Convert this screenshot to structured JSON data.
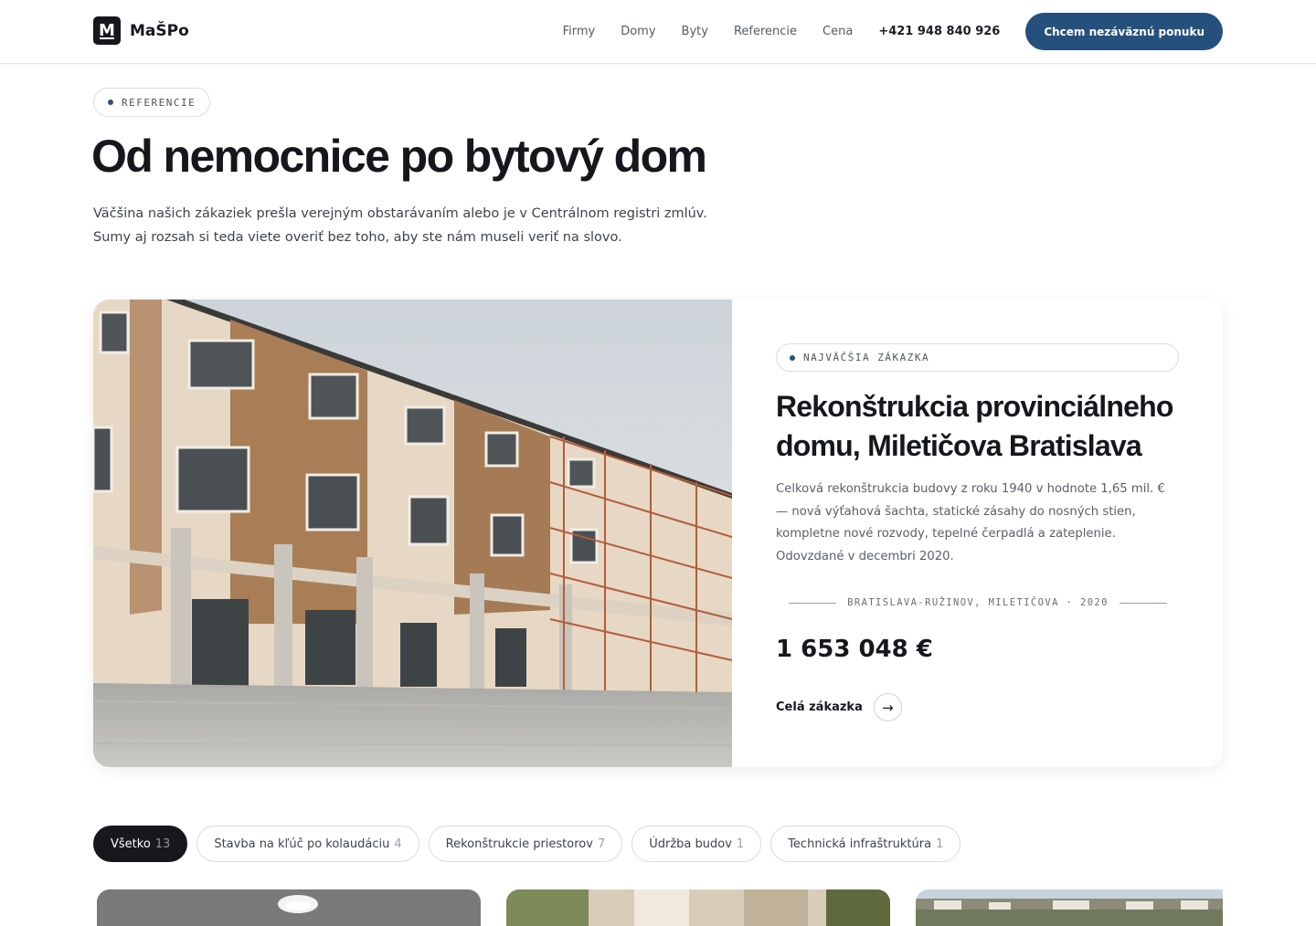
{
  "header": {
    "logo_mark": "M",
    "logo_text": "MaŠPo",
    "nav": [
      "Firmy",
      "Domy",
      "Byty",
      "Referencie",
      "Cena"
    ],
    "phone": "+421 948 840 926",
    "cta": "Chcem nezáväznú ponuku"
  },
  "hero": {
    "tag": "REFERENCIE",
    "title": "Od nemocnice po bytový dom",
    "text_line1": "Väčšina našich zákaziek prešla verejným obstarávaním alebo je v Centrálnom registri zmlúv.",
    "text_line2": "Sumy aj rozsah si teda viete overiť bez toho, aby ste nám museli veriť na slovo."
  },
  "featured": {
    "tag": "NAJVÄČŠIA ZÁKAZKA",
    "title": "Rekonštrukcia provinciálneho domu, Miletičova Bratislava",
    "description": "Celková rekonštrukcia budovy z roku 1940 v hodnote 1,65 mil. € — nová výťahová šachta, statické zásahy do nosných stien, kompletne nové rozvody, tepelné čerpadlá a zateplenie. Odovzdané v decembri 2020.",
    "meta": "BRATISLAVA-RUŽINOV, MILETIČOVA · 2020",
    "price": "1 653 048 €",
    "link_label": "Celá zákazka",
    "arrow": "→"
  },
  "filters": [
    {
      "label": "Všetko",
      "count": "13",
      "active": true
    },
    {
      "label": "Stavba na kľúč po kolaudáciu",
      "count": "4",
      "active": false
    },
    {
      "label": "Rekonštrukcie priestorov",
      "count": "7",
      "active": false
    },
    {
      "label": "Údržba budov",
      "count": "1",
      "active": false
    },
    {
      "label": "Technická infraštruktúra",
      "count": "1",
      "active": false
    }
  ],
  "colors": {
    "accent": "#26507c",
    "dark": "#16181d"
  }
}
